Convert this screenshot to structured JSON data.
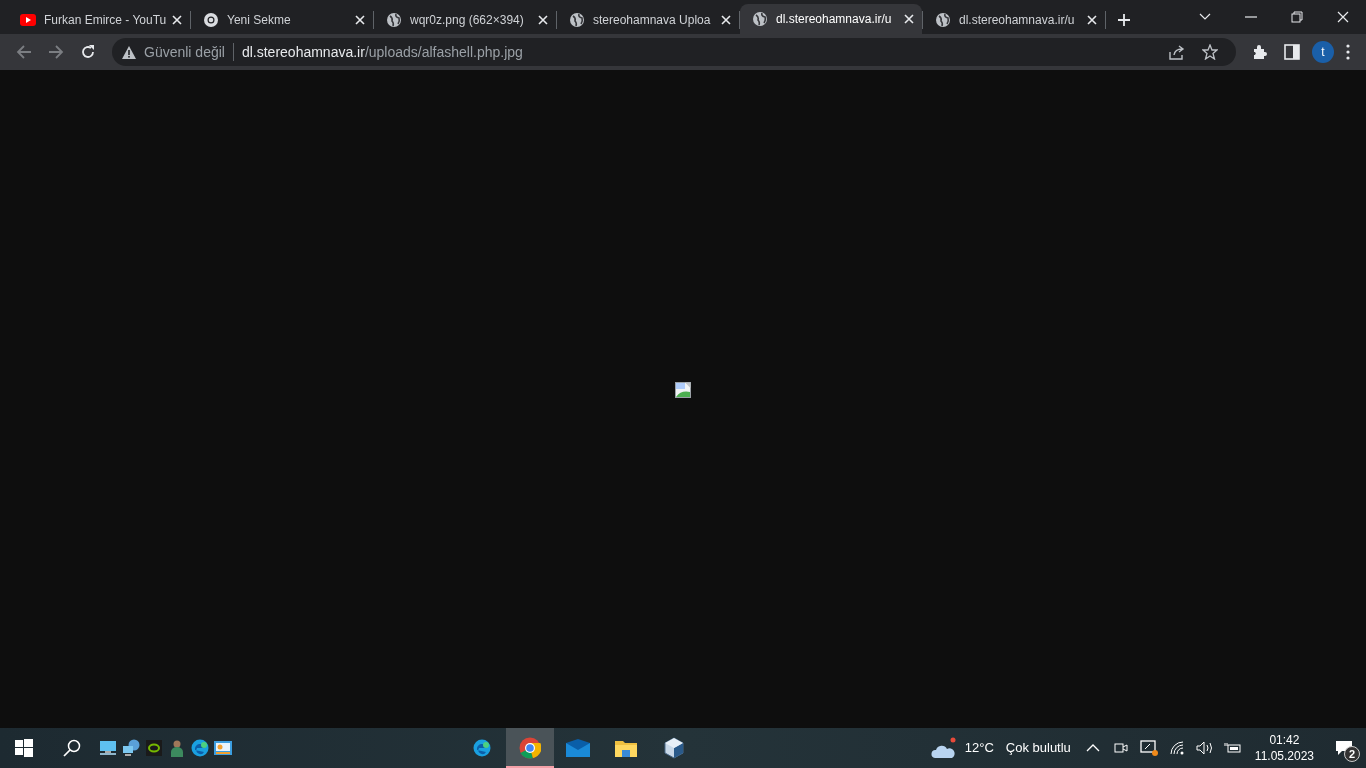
{
  "tabs": [
    {
      "title": "Furkan Emirce - YouTu",
      "kind": "youtube",
      "selected": false
    },
    {
      "title": "Yeni Sekme",
      "kind": "chrome",
      "selected": false
    },
    {
      "title": "wqr0z.png (662×394)",
      "kind": "globe",
      "selected": false
    },
    {
      "title": "stereohamnava Uploa",
      "kind": "globe",
      "selected": false
    },
    {
      "title": "dl.stereohamnava.ir/u",
      "kind": "globe",
      "selected": true
    },
    {
      "title": "dl.stereohamnava.ir/u",
      "kind": "globe",
      "selected": false
    }
  ],
  "address_bar": {
    "security": "Güvenli değil",
    "host": "dl.stereohamnava.ir",
    "path": "/uploads/alfashell.php.jpg"
  },
  "profile": {
    "initial": "t"
  },
  "page": {
    "content": [
      {
        "kind": "broken-image"
      }
    ]
  },
  "taskbar": {
    "left_icons": [
      {
        "kind": "monitor"
      },
      {
        "kind": "network"
      },
      {
        "kind": "gpu"
      },
      {
        "kind": "person"
      },
      {
        "kind": "edge"
      },
      {
        "kind": "panel"
      }
    ],
    "apps": [
      {
        "kind": "edge",
        "selected": false
      },
      {
        "kind": "chrome",
        "selected": true
      },
      {
        "kind": "mail",
        "selected": false
      },
      {
        "kind": "folder",
        "selected": false
      },
      {
        "kind": "cube",
        "selected": false
      }
    ],
    "weather": {
      "temperature": "12°C",
      "condition": "Çok bulutlu"
    },
    "time": "01:42",
    "date": "11.05.2023",
    "notifications": "2"
  }
}
